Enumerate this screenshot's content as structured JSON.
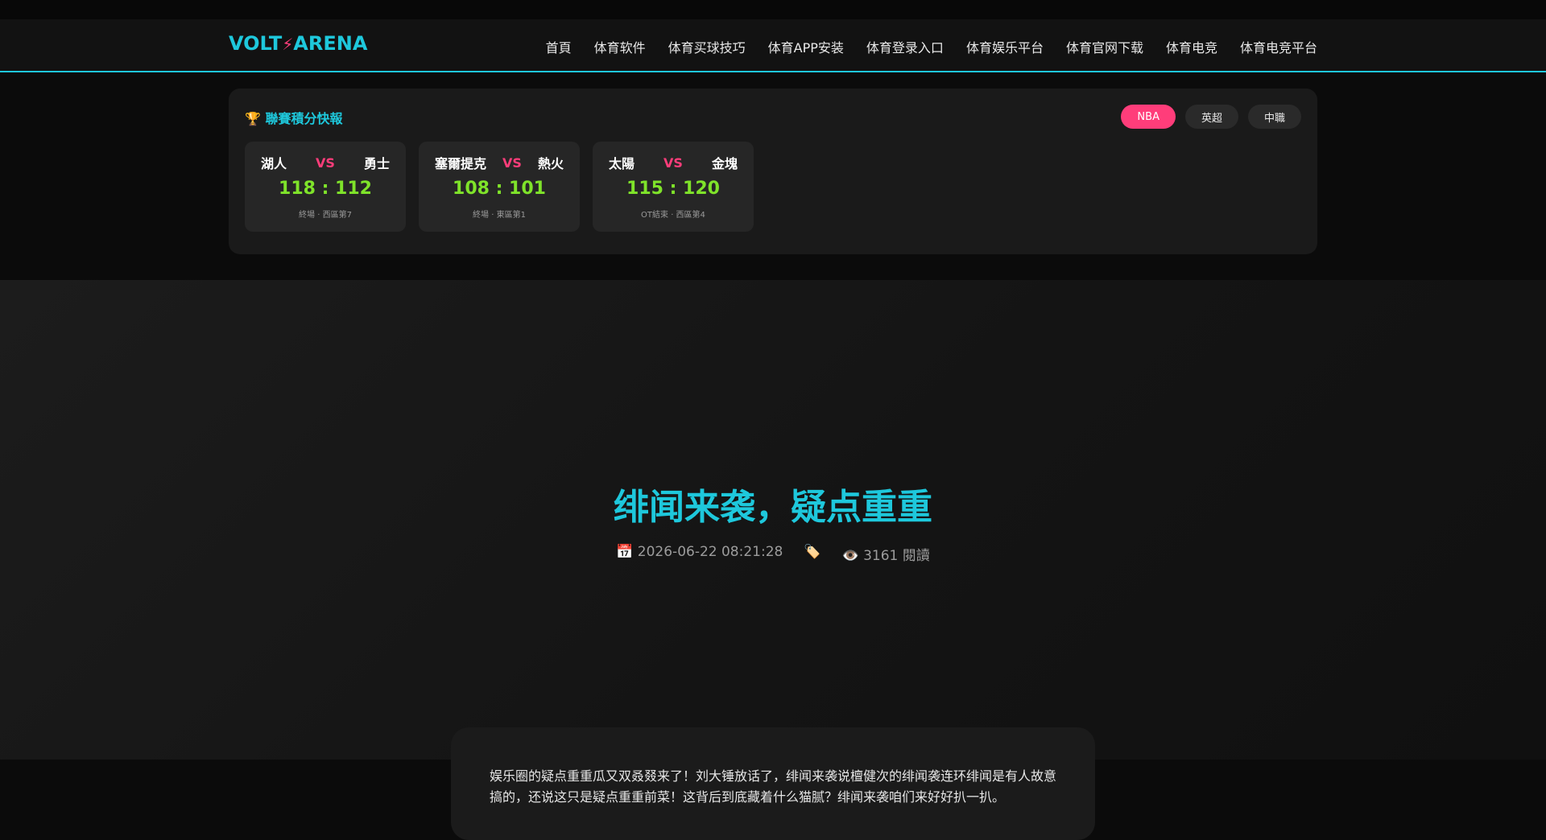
{
  "header": {
    "logo_part1": "VOLT",
    "logo_bolt": "⚡",
    "logo_part2": "ARENA",
    "nav": [
      "首頁",
      "体育软件",
      "体育买球技巧",
      "体育APP安装",
      "体育登录入口",
      "体育娱乐平台",
      "体育官网下载",
      "体育电竞",
      "体育电竞平台"
    ]
  },
  "scores": {
    "title": "🏆 聯賽積分快報",
    "tabs": [
      {
        "label": "NBA",
        "active": true
      },
      {
        "label": "英超",
        "active": false
      },
      {
        "label": "中職",
        "active": false
      }
    ],
    "games": [
      {
        "home": "湖人",
        "vs": "VS",
        "away": "勇士",
        "score": "118 : 112",
        "status": "終場 · 西區第7"
      },
      {
        "home": "塞爾提克",
        "vs": "VS",
        "away": "熱火",
        "score": "108 : 101",
        "status": "終場 · 東區第1"
      },
      {
        "home": "太陽",
        "vs": "VS",
        "away": "金塊",
        "score": "115 : 120",
        "status": "OT結束 · 西區第4"
      }
    ]
  },
  "article": {
    "title": "绯闻来袭，疑点重重",
    "date": "📅 2026-06-22 08:21:28",
    "tag_icon": "🏷️",
    "views": "👁️ 3161 閱讀",
    "body": "娱乐圈的疑点重重瓜又双叒叕来了！刘大锤放话了，绯闻来袭说檀健次的绯闻袭连环绯闻是有人故意搞的，还说这只是疑点重重前菜！这背后到底藏着什么猫腻？绯闻来袭咱们来好好扒一扒。"
  },
  "colors": {
    "accent": "#1ec8dc",
    "pink": "#ff3d7a",
    "score_green": "#7fe32a"
  }
}
